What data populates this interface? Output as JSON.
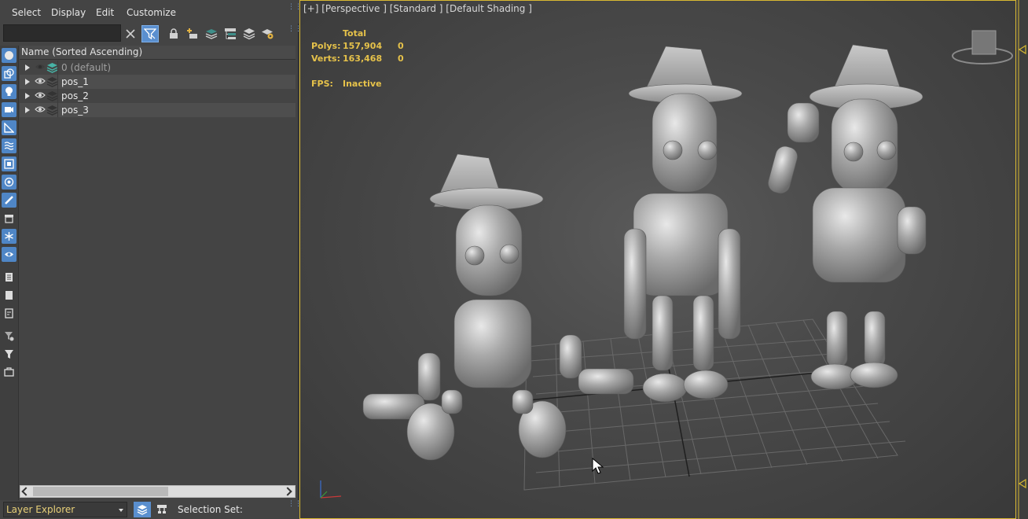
{
  "menu": {
    "select": "Select",
    "display": "Display",
    "edit": "Edit",
    "customize": "Customize"
  },
  "search": {
    "value": "",
    "placeholder": ""
  },
  "tree": {
    "header": "Name (Sorted Ascending)",
    "rows": [
      {
        "label": "0 (default)",
        "visible": false,
        "current": true
      },
      {
        "label": "pos_1",
        "visible": true
      },
      {
        "label": "pos_2",
        "visible": true
      },
      {
        "label": "pos_3",
        "visible": true
      }
    ]
  },
  "bottom": {
    "explorer": "Layer Explorer",
    "selection_set": "Selection Set:"
  },
  "viewport": {
    "label": "[+] [Perspective ] [Standard ] [Default Shading ]",
    "stats": {
      "header": "Total",
      "polys_label": "Polys:",
      "polys_value": "157,904",
      "polys_sel": "0",
      "verts_label": "Verts:",
      "verts_value": "163,468",
      "verts_sel": "0",
      "fps_label": "FPS:",
      "fps_value": "Inactive"
    }
  },
  "colors": {
    "accent_blue": "#5a8fcf",
    "stats_yellow": "#e6c24a",
    "viewport_border": "#d8b832"
  }
}
